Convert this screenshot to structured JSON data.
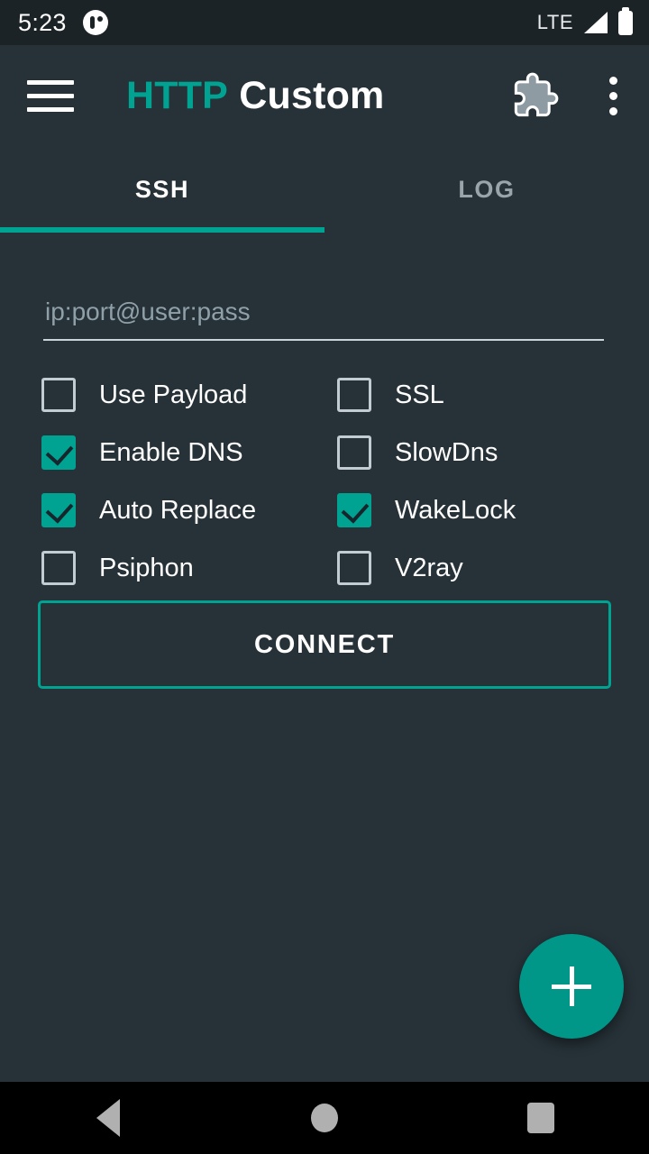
{
  "status_bar": {
    "time": "5:23",
    "notification_icon": "app-notification-icon",
    "network_label": "LTE",
    "signal_icon": "signal-bars-icon",
    "battery_icon": "battery-full-icon"
  },
  "app_bar": {
    "menu_icon": "hamburger-menu-icon",
    "title_primary": "HTTP",
    "title_secondary": "Custom",
    "plugin_icon": "puzzle-piece-icon",
    "overflow_icon": "overflow-menu-icon"
  },
  "tabs": [
    {
      "label": "SSH",
      "active": true
    },
    {
      "label": "LOG",
      "active": false
    }
  ],
  "form": {
    "host_placeholder": "ip:port@user:pass",
    "host_value": ""
  },
  "options": [
    {
      "label": "Use Payload",
      "checked": false
    },
    {
      "label": "SSL",
      "checked": false
    },
    {
      "label": "Enable DNS",
      "checked": true
    },
    {
      "label": "SlowDns",
      "checked": false
    },
    {
      "label": "Auto Replace",
      "checked": true
    },
    {
      "label": "WakeLock",
      "checked": true
    },
    {
      "label": "Psiphon",
      "checked": false
    },
    {
      "label": "V2ray",
      "checked": false
    }
  ],
  "actions": {
    "connect_label": "CONNECT",
    "fab_icon": "plus-icon"
  },
  "nav_bar": {
    "back": "back-icon",
    "home": "home-icon",
    "recents": "recents-icon"
  },
  "colors": {
    "accent": "#00a291",
    "background": "#263238",
    "status_bar": "#1b2327",
    "nav_bar": "#000000",
    "text_primary": "#ffffff",
    "text_muted": "#90a0a8"
  }
}
